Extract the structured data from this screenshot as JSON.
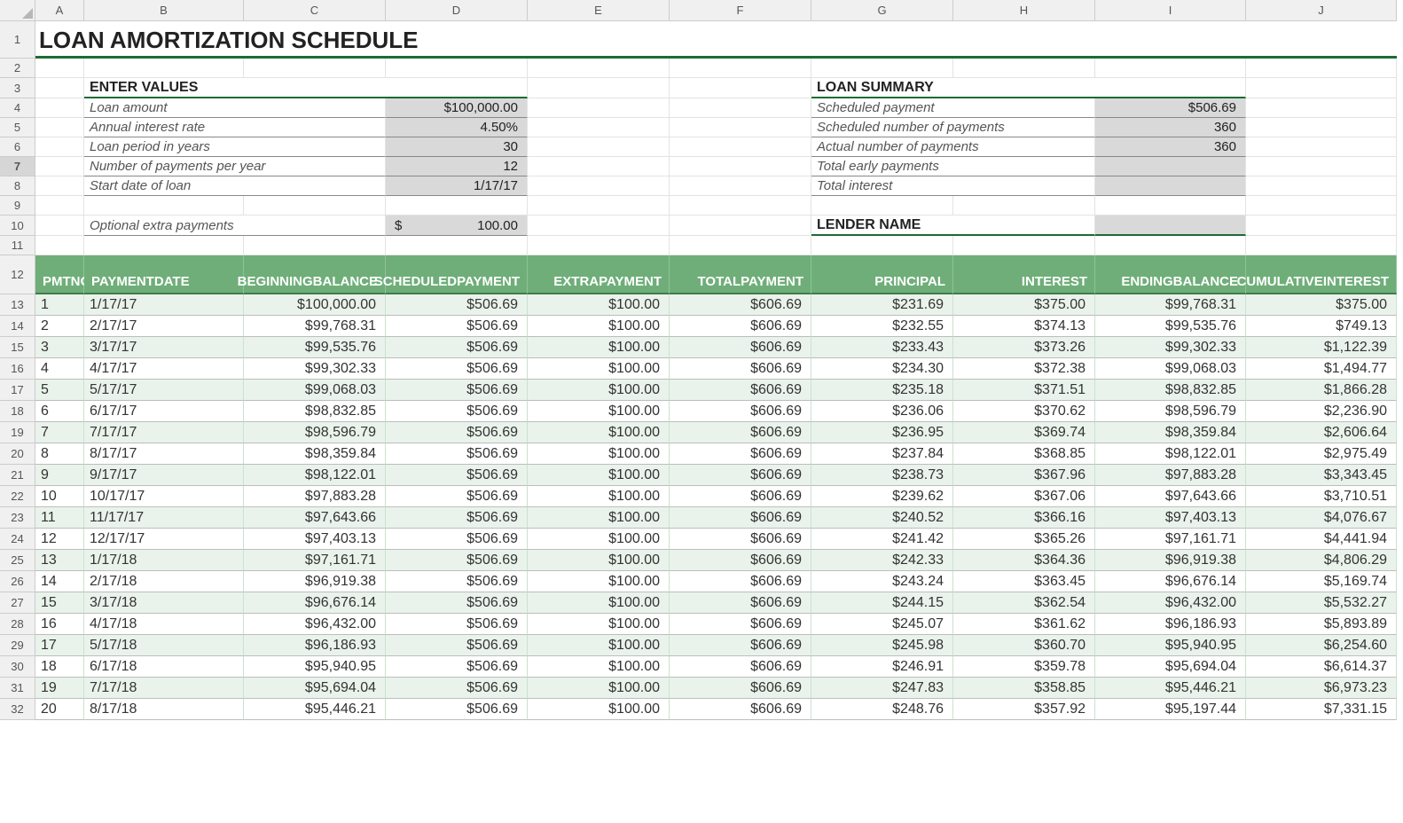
{
  "columns": [
    "A",
    "B",
    "C",
    "D",
    "E",
    "F",
    "G",
    "H",
    "I",
    "J"
  ],
  "title": "LOAN AMORTIZATION SCHEDULE",
  "enter_values": {
    "heading": "ENTER VALUES",
    "rows": [
      {
        "label": "Loan amount",
        "value": "$100,000.00"
      },
      {
        "label": "Annual interest rate",
        "value": "4.50%"
      },
      {
        "label": "Loan period in years",
        "value": "30"
      },
      {
        "label": "Number of payments per year",
        "value": "12"
      },
      {
        "label": "Start date of loan",
        "value": "1/17/17"
      }
    ],
    "extra": {
      "label": "Optional extra payments",
      "currency": "$",
      "value": "100.00"
    }
  },
  "loan_summary": {
    "heading": "LOAN SUMMARY",
    "rows": [
      {
        "label": "Scheduled payment",
        "value": "$506.69"
      },
      {
        "label": "Scheduled number of payments",
        "value": "360"
      },
      {
        "label": "Actual number of payments",
        "value": "360"
      },
      {
        "label": "Total early payments",
        "value": ""
      },
      {
        "label": "Total interest",
        "value": ""
      }
    ],
    "lender_heading": "LENDER NAME"
  },
  "table": {
    "headers": [
      "PMT NO",
      "PAYMENT DATE",
      "BEGINNING BALANCE",
      "SCHEDULED PAYMENT",
      "EXTRA PAYMENT",
      "TOTAL PAYMENT",
      "PRINCIPAL",
      "INTEREST",
      "ENDING BALANCE",
      "CUMULATIVE INTEREST"
    ],
    "rows": [
      {
        "no": "1",
        "date": "1/17/17",
        "beg": "$100,000.00",
        "sched": "$506.69",
        "extra": "$100.00",
        "total": "$606.69",
        "prin": "$231.69",
        "int": "$375.00",
        "end": "$99,768.31",
        "cum": "$375.00"
      },
      {
        "no": "2",
        "date": "2/17/17",
        "beg": "$99,768.31",
        "sched": "$506.69",
        "extra": "$100.00",
        "total": "$606.69",
        "prin": "$232.55",
        "int": "$374.13",
        "end": "$99,535.76",
        "cum": "$749.13"
      },
      {
        "no": "3",
        "date": "3/17/17",
        "beg": "$99,535.76",
        "sched": "$506.69",
        "extra": "$100.00",
        "total": "$606.69",
        "prin": "$233.43",
        "int": "$373.26",
        "end": "$99,302.33",
        "cum": "$1,122.39"
      },
      {
        "no": "4",
        "date": "4/17/17",
        "beg": "$99,302.33",
        "sched": "$506.69",
        "extra": "$100.00",
        "total": "$606.69",
        "prin": "$234.30",
        "int": "$372.38",
        "end": "$99,068.03",
        "cum": "$1,494.77"
      },
      {
        "no": "5",
        "date": "5/17/17",
        "beg": "$99,068.03",
        "sched": "$506.69",
        "extra": "$100.00",
        "total": "$606.69",
        "prin": "$235.18",
        "int": "$371.51",
        "end": "$98,832.85",
        "cum": "$1,866.28"
      },
      {
        "no": "6",
        "date": "6/17/17",
        "beg": "$98,832.85",
        "sched": "$506.69",
        "extra": "$100.00",
        "total": "$606.69",
        "prin": "$236.06",
        "int": "$370.62",
        "end": "$98,596.79",
        "cum": "$2,236.90"
      },
      {
        "no": "7",
        "date": "7/17/17",
        "beg": "$98,596.79",
        "sched": "$506.69",
        "extra": "$100.00",
        "total": "$606.69",
        "prin": "$236.95",
        "int": "$369.74",
        "end": "$98,359.84",
        "cum": "$2,606.64"
      },
      {
        "no": "8",
        "date": "8/17/17",
        "beg": "$98,359.84",
        "sched": "$506.69",
        "extra": "$100.00",
        "total": "$606.69",
        "prin": "$237.84",
        "int": "$368.85",
        "end": "$98,122.01",
        "cum": "$2,975.49"
      },
      {
        "no": "9",
        "date": "9/17/17",
        "beg": "$98,122.01",
        "sched": "$506.69",
        "extra": "$100.00",
        "total": "$606.69",
        "prin": "$238.73",
        "int": "$367.96",
        "end": "$97,883.28",
        "cum": "$3,343.45"
      },
      {
        "no": "10",
        "date": "10/17/17",
        "beg": "$97,883.28",
        "sched": "$506.69",
        "extra": "$100.00",
        "total": "$606.69",
        "prin": "$239.62",
        "int": "$367.06",
        "end": "$97,643.66",
        "cum": "$3,710.51"
      },
      {
        "no": "11",
        "date": "11/17/17",
        "beg": "$97,643.66",
        "sched": "$506.69",
        "extra": "$100.00",
        "total": "$606.69",
        "prin": "$240.52",
        "int": "$366.16",
        "end": "$97,403.13",
        "cum": "$4,076.67"
      },
      {
        "no": "12",
        "date": "12/17/17",
        "beg": "$97,403.13",
        "sched": "$506.69",
        "extra": "$100.00",
        "total": "$606.69",
        "prin": "$241.42",
        "int": "$365.26",
        "end": "$97,161.71",
        "cum": "$4,441.94"
      },
      {
        "no": "13",
        "date": "1/17/18",
        "beg": "$97,161.71",
        "sched": "$506.69",
        "extra": "$100.00",
        "total": "$606.69",
        "prin": "$242.33",
        "int": "$364.36",
        "end": "$96,919.38",
        "cum": "$4,806.29"
      },
      {
        "no": "14",
        "date": "2/17/18",
        "beg": "$96,919.38",
        "sched": "$506.69",
        "extra": "$100.00",
        "total": "$606.69",
        "prin": "$243.24",
        "int": "$363.45",
        "end": "$96,676.14",
        "cum": "$5,169.74"
      },
      {
        "no": "15",
        "date": "3/17/18",
        "beg": "$96,676.14",
        "sched": "$506.69",
        "extra": "$100.00",
        "total": "$606.69",
        "prin": "$244.15",
        "int": "$362.54",
        "end": "$96,432.00",
        "cum": "$5,532.27"
      },
      {
        "no": "16",
        "date": "4/17/18",
        "beg": "$96,432.00",
        "sched": "$506.69",
        "extra": "$100.00",
        "total": "$606.69",
        "prin": "$245.07",
        "int": "$361.62",
        "end": "$96,186.93",
        "cum": "$5,893.89"
      },
      {
        "no": "17",
        "date": "5/17/18",
        "beg": "$96,186.93",
        "sched": "$506.69",
        "extra": "$100.00",
        "total": "$606.69",
        "prin": "$245.98",
        "int": "$360.70",
        "end": "$95,940.95",
        "cum": "$6,254.60"
      },
      {
        "no": "18",
        "date": "6/17/18",
        "beg": "$95,940.95",
        "sched": "$506.69",
        "extra": "$100.00",
        "total": "$606.69",
        "prin": "$246.91",
        "int": "$359.78",
        "end": "$95,694.04",
        "cum": "$6,614.37"
      },
      {
        "no": "19",
        "date": "7/17/18",
        "beg": "$95,694.04",
        "sched": "$506.69",
        "extra": "$100.00",
        "total": "$606.69",
        "prin": "$247.83",
        "int": "$358.85",
        "end": "$95,446.21",
        "cum": "$6,973.23"
      },
      {
        "no": "20",
        "date": "8/17/18",
        "beg": "$95,446.21",
        "sched": "$506.69",
        "extra": "$100.00",
        "total": "$606.69",
        "prin": "$248.76",
        "int": "$357.92",
        "end": "$95,197.44",
        "cum": "$7,331.15"
      }
    ]
  },
  "row_numbers": [
    "1",
    "2",
    "3",
    "4",
    "5",
    "6",
    "7",
    "8",
    "9",
    "10",
    "11",
    "12",
    "13",
    "14",
    "15",
    "16",
    "17",
    "18",
    "19",
    "20",
    "21",
    "22",
    "23",
    "24",
    "25",
    "26",
    "27",
    "28",
    "29",
    "30",
    "31",
    "32"
  ],
  "selected_row_header": "7"
}
